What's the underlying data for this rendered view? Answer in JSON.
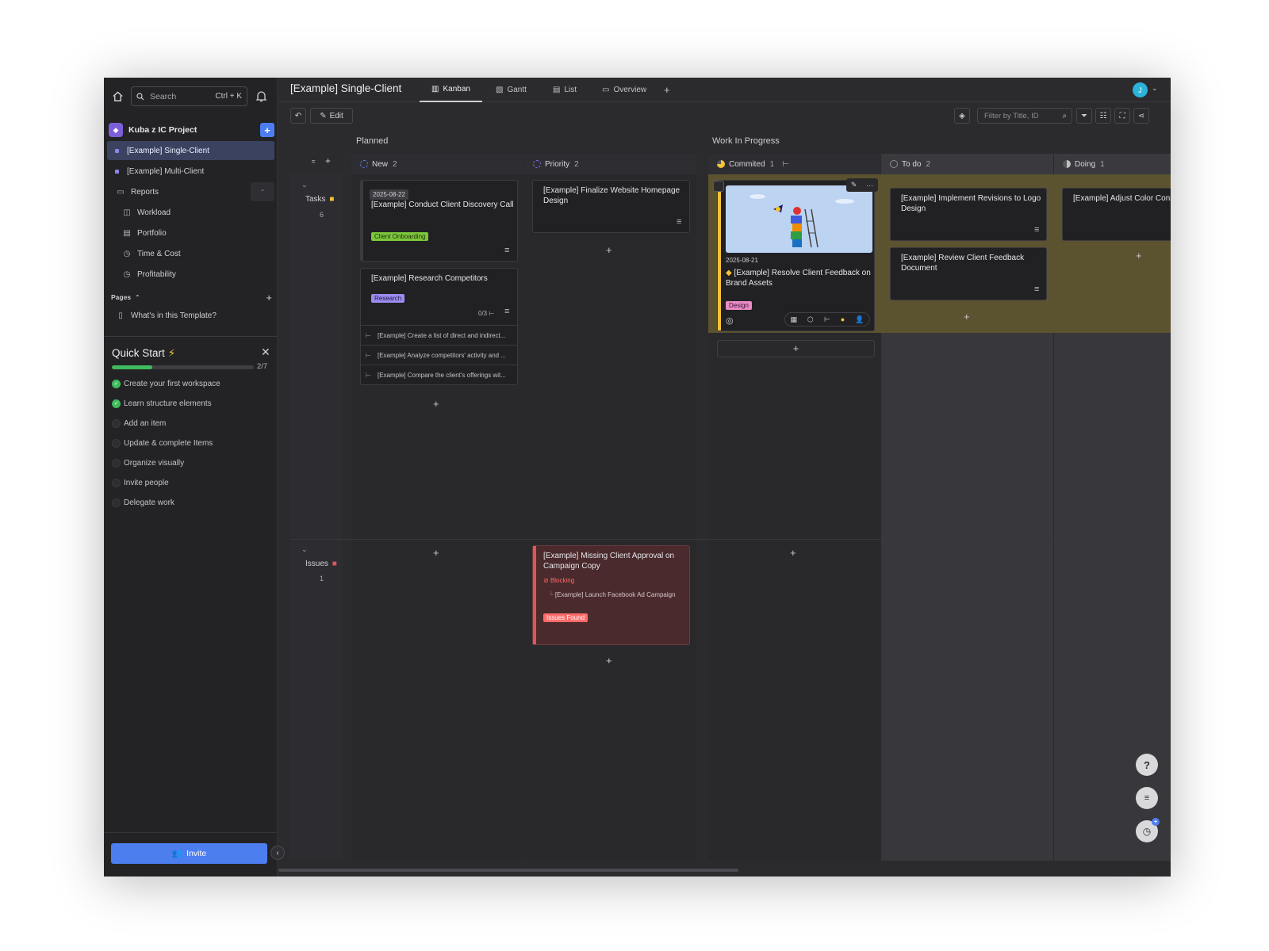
{
  "sidebar": {
    "search_placeholder": "Search",
    "search_shortcut": "Ctrl + K",
    "workspace_name": "Kuba z IC Project",
    "items": [
      {
        "label": "[Example] Single-Client"
      },
      {
        "label": "[Example] Multi-Client"
      },
      {
        "label": "Reports"
      },
      {
        "label": "Workload"
      },
      {
        "label": "Portfolio"
      },
      {
        "label": "Time & Cost"
      },
      {
        "label": "Profitability"
      }
    ],
    "pages_label": "Pages",
    "pages": [
      {
        "label": "What's in this Template?"
      }
    ],
    "quick_start": {
      "title": "Quick Start",
      "progress": 0.2857,
      "count": "2/7",
      "steps": [
        {
          "label": "Create your first workspace",
          "done": true
        },
        {
          "label": "Learn structure elements",
          "done": true
        },
        {
          "label": "Add an item",
          "done": false
        },
        {
          "label": "Update & complete Items",
          "done": false
        },
        {
          "label": "Organize visually",
          "done": false
        },
        {
          "label": "Invite people",
          "done": false
        },
        {
          "label": "Delegate work",
          "done": false
        }
      ]
    },
    "invite_label": "Invite"
  },
  "header": {
    "title": "[Example] Single-Client",
    "tabs": [
      {
        "label": "Kanban"
      },
      {
        "label": "Gantt"
      },
      {
        "label": "List"
      },
      {
        "label": "Overview"
      }
    ],
    "avatar_initial": "J"
  },
  "toolbar": {
    "edit_label": "Edit",
    "filter_placeholder": "Filter by Title, ID"
  },
  "board": {
    "groups": [
      "Planned",
      "Work In Progress"
    ],
    "columns": [
      {
        "label": "New",
        "count": "2"
      },
      {
        "label": "Priority",
        "count": "2"
      },
      {
        "label": "Commited",
        "count": "1"
      },
      {
        "label": "To do",
        "count": "2"
      },
      {
        "label": "Doing",
        "count": "1"
      }
    ],
    "rows": [
      {
        "label": "Tasks",
        "count": "6"
      },
      {
        "label": "Issues",
        "count": "1"
      }
    ],
    "cards": {
      "discovery": {
        "date": "2025-08-22",
        "title": "[Example] Conduct Client Discovery Call",
        "tag": "Client Onboarding"
      },
      "research": {
        "title": "[Example] Research Competitors",
        "tag": "Research",
        "subtasks_count": "0/3",
        "subtasks": [
          "[Example] Create a list of direct and indirect...",
          "[Example] Analyze competitors' activity and ...",
          "[Example] Compare the client's offerings wit..."
        ]
      },
      "homepage": {
        "title": "[Example] Finalize Website Homepage Design"
      },
      "brand": {
        "date": "2025-08-21",
        "title": "[Example] Resolve Client Feedback on Brand Assets",
        "tag": "Design"
      },
      "revisions": {
        "title": "[Example] Implement Revisions to Logo Design"
      },
      "review": {
        "title": "[Example] Review Client Feedback Document"
      },
      "color": {
        "title": "[Example] Adjust Color Consistency"
      },
      "approval": {
        "title": "[Example] Missing Client Approval on Campaign Copy",
        "blocking_label": "Blocking",
        "blocked_item": "[Example] Launch Facebook Ad Campaign",
        "tag": "Issues Found"
      }
    }
  },
  "colors": {
    "accent": "#4d7ef0",
    "wip_highlight": "#5b5230",
    "issue_card": "#4a2a2c",
    "issue_border": "#e05558",
    "progress": "#3fbb5d"
  }
}
